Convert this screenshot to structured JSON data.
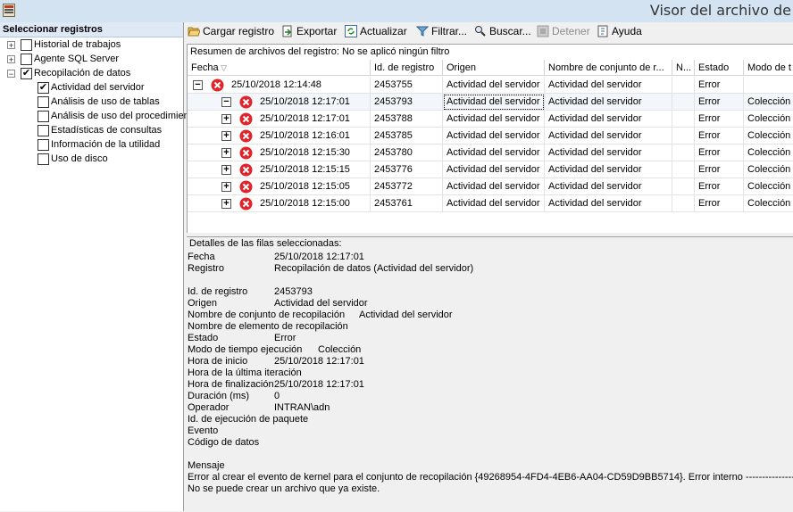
{
  "window": {
    "title": "Visor del archivo de"
  },
  "left_panel": {
    "header": "Seleccionar registros",
    "items": [
      {
        "label": "Historial de trabajos",
        "checked": false,
        "expander": "+"
      },
      {
        "label": "Agente SQL Server",
        "checked": false,
        "expander": "+"
      },
      {
        "label": "Recopilación de datos",
        "checked": true,
        "expander": "−"
      },
      {
        "label": "Actividad del servidor",
        "checked": true
      },
      {
        "label": "Análisis de uso de tablas",
        "checked": false
      },
      {
        "label": "Análisis de uso del procedimien",
        "checked": false
      },
      {
        "label": "Estadísticas de consultas",
        "checked": false
      },
      {
        "label": "Información de la utilidad",
        "checked": false
      },
      {
        "label": "Uso de disco",
        "checked": false
      }
    ]
  },
  "toolbar": {
    "load": "Cargar registro",
    "export": "Exportar",
    "refresh": "Actualizar",
    "filter": "Filtrar...",
    "search": "Buscar...",
    "stop": "Detener",
    "help": "Ayuda"
  },
  "grid": {
    "summary": "Resumen de archivos del registro: No se aplicó ningún filtro",
    "columns": [
      "Fecha",
      "Id. de registro",
      "Origen",
      "Nombre de conjunto de r...",
      "N...",
      "Estado",
      "Modo de t"
    ],
    "rows": [
      {
        "date": "25/10/2018 12:14:48",
        "id": "2453755",
        "origin": "Actividad del servidor",
        "set": "Actividad del servidor",
        "n": "",
        "state": "Error",
        "mode": "",
        "level": 0,
        "expander": "−"
      },
      {
        "date": "25/10/2018 12:17:01",
        "id": "2453793",
        "origin": "Actividad del servidor",
        "set": "Actividad del servidor",
        "n": "",
        "state": "Error",
        "mode": "Colección",
        "level": 1,
        "expander": "−"
      },
      {
        "date": "25/10/2018 12:17:01",
        "id": "2453788",
        "origin": "Actividad del servidor",
        "set": "Actividad del servidor",
        "n": "",
        "state": "Error",
        "mode": "Colección",
        "level": 1,
        "expander": "+"
      },
      {
        "date": "25/10/2018 12:16:01",
        "id": "2453785",
        "origin": "Actividad del servidor",
        "set": "Actividad del servidor",
        "n": "",
        "state": "Error",
        "mode": "Colección",
        "level": 1,
        "expander": "+"
      },
      {
        "date": "25/10/2018 12:15:30",
        "id": "2453780",
        "origin": "Actividad del servidor",
        "set": "Actividad del servidor",
        "n": "",
        "state": "Error",
        "mode": "Colección",
        "level": 1,
        "expander": "+"
      },
      {
        "date": "25/10/2018 12:15:15",
        "id": "2453776",
        "origin": "Actividad del servidor",
        "set": "Actividad del servidor",
        "n": "",
        "state": "Error",
        "mode": "Colección",
        "level": 1,
        "expander": "+"
      },
      {
        "date": "25/10/2018 12:15:05",
        "id": "2453772",
        "origin": "Actividad del servidor",
        "set": "Actividad del servidor",
        "n": "",
        "state": "Error",
        "mode": "Colección",
        "level": 1,
        "expander": "+"
      },
      {
        "date": "25/10/2018 12:15:00",
        "id": "2453761",
        "origin": "Actividad del servidor",
        "set": "Actividad del servidor",
        "n": "",
        "state": "Error",
        "mode": "Colección",
        "level": 1,
        "expander": "+"
      }
    ]
  },
  "details": {
    "header": "Detalles de las filas seleccionadas:",
    "fields": [
      {
        "label": "Fecha",
        "value": "25/10/2018 12:17:01"
      },
      {
        "label": "Registro",
        "value": "Recopilación de datos (Actividad del servidor)"
      },
      {
        "label": "",
        "value": ""
      },
      {
        "label": "Id. de registro",
        "value": "2453793"
      },
      {
        "label": "Origen",
        "value": "Actividad del servidor"
      },
      {
        "label": "Nombre de conjunto de recopilación",
        "value": "Actividad del servidor"
      },
      {
        "label": "Nombre de elemento de recopilación",
        "value": ""
      },
      {
        "label": "Estado",
        "value": "Error"
      },
      {
        "label": "Modo de tiempo ejecución",
        "value": "Colección"
      },
      {
        "label": "Hora de inicio",
        "value": "25/10/2018 12:17:01"
      },
      {
        "label": "Hora de la última iteración",
        "value": ""
      },
      {
        "label": "Hora de finalización",
        "value": "25/10/2018 12:17:01"
      },
      {
        "label": "Duración (ms)",
        "value": "0"
      },
      {
        "label": "Operador",
        "value": "INTRAN\\adn"
      },
      {
        "label": "Id. de ejecución de paquete",
        "value": ""
      },
      {
        "label": "Evento",
        "value": ""
      },
      {
        "label": "Código de datos",
        "value": ""
      }
    ],
    "message_label": "Mensaje",
    "message_line1": "Error al crear el evento de kernel para el conjunto de recopilación {49268954-4FD4-4EB6-AA04-CD59D9BB5714}. Error interno ------------------->",
    "message_line2": "No se puede crear un archivo que ya existe."
  },
  "colors": {
    "error_red": "#e2232a",
    "title_bg": "#d3e3f2",
    "header_bg": "#dfe9f5"
  }
}
